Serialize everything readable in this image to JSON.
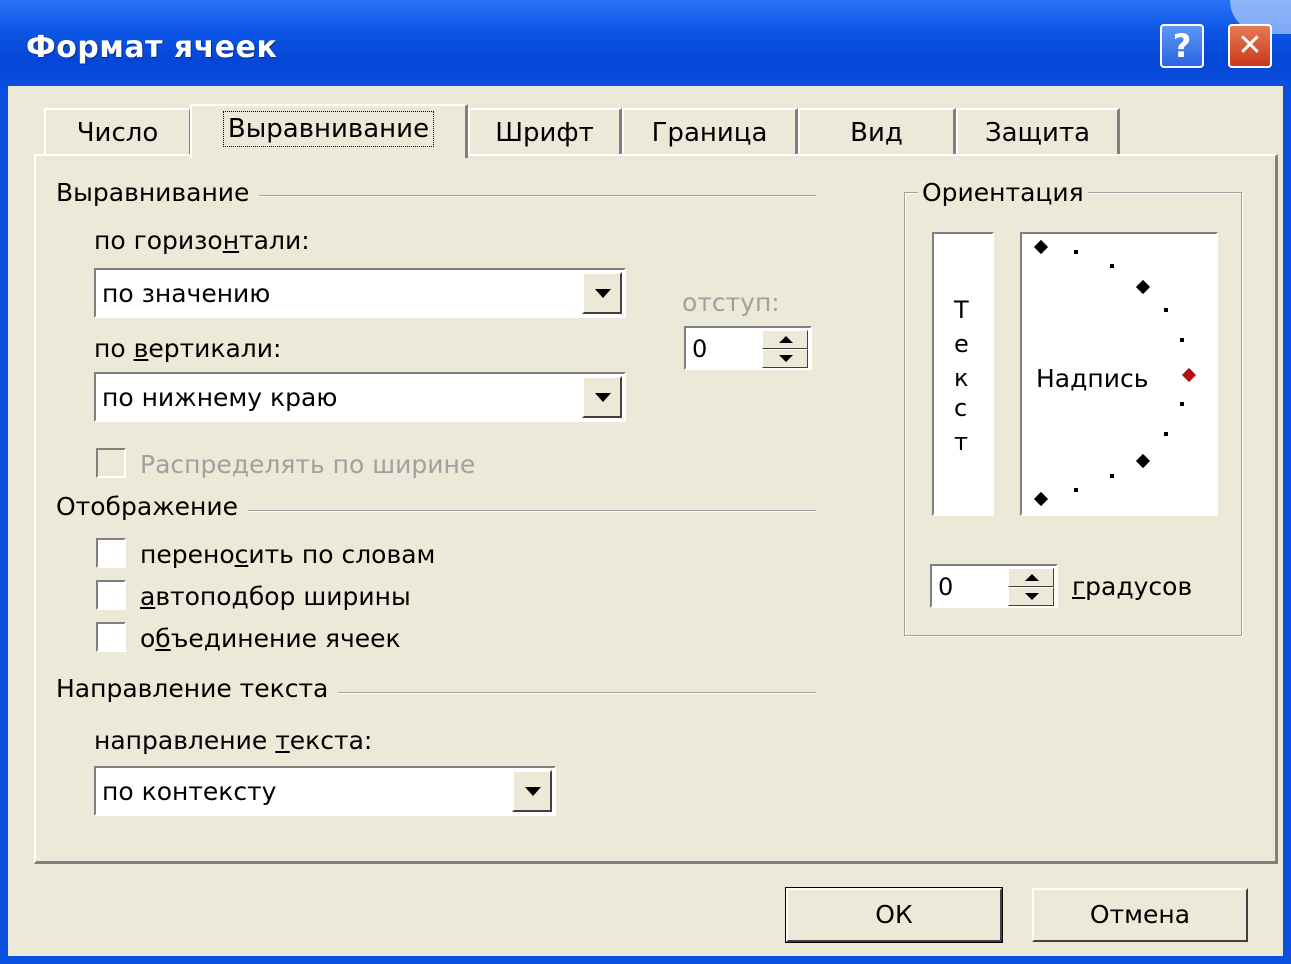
{
  "window": {
    "title": "Формат ячеек",
    "help_glyph": "?",
    "close_glyph": "✕"
  },
  "tabs": [
    {
      "label": "Число",
      "active": false
    },
    {
      "label": "Выравнивание",
      "active": true
    },
    {
      "label": "Шрифт",
      "active": false
    },
    {
      "label": "Граница",
      "active": false
    },
    {
      "label": "Вид",
      "active": false
    },
    {
      "label": "Защита",
      "active": false
    }
  ],
  "alignment": {
    "group_label": "Выравнивание",
    "horizontal": {
      "label_pre": "по горизо",
      "label_u": "н",
      "label_post": "тали:",
      "value": "по значению"
    },
    "vertical": {
      "label_pre": "по ",
      "label_u": "в",
      "label_post": "ертикали:",
      "value": "по нижнему краю"
    },
    "indent": {
      "label": "отступ:",
      "value": "0"
    },
    "distribute": {
      "label": "Распределять по ширине",
      "checked": false,
      "disabled": true
    }
  },
  "display": {
    "group_label": "Отображение",
    "wrap": {
      "label_pre": "перено",
      "label_u": "с",
      "label_post": "ить по словам",
      "checked": false
    },
    "autofit": {
      "label_pre": "",
      "label_u": "а",
      "label_post": "втоподбор ширины",
      "checked": false
    },
    "merge": {
      "label_pre": "о",
      "label_u": "б",
      "label_post": "ъединение ячеек",
      "checked": false
    }
  },
  "text_direction": {
    "group_label": "Направление текста",
    "label_pre": "направление ",
    "label_u": "т",
    "label_post": "екста:",
    "value": "по контексту"
  },
  "orientation": {
    "group_label": "Ориентация",
    "vertical_letters": [
      "Т",
      "е",
      "к",
      "с",
      "т"
    ],
    "dial_label": "Надпись",
    "degrees_value": "0",
    "degrees_label_u": "г",
    "degrees_label_post": "радусов",
    "marker_color": "#b01010"
  },
  "buttons": {
    "ok": "ОК",
    "cancel": "Отмена"
  },
  "colors": {
    "title_bar": "#0a4fe0",
    "face": "#ece9d8",
    "close": "#c9391c"
  }
}
